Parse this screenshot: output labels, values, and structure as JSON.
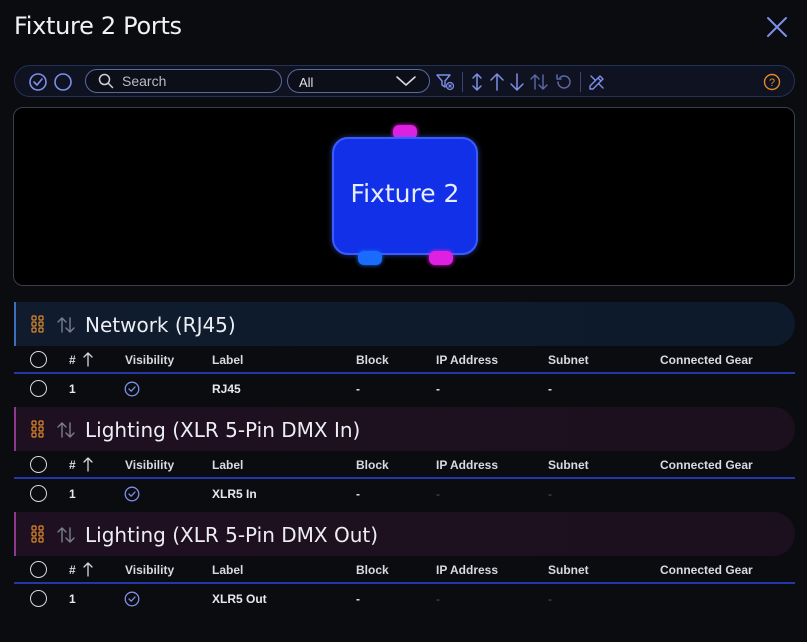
{
  "window": {
    "title": "Fixture 2 Ports"
  },
  "toolbar": {
    "search_placeholder": "Search",
    "filter_value": "All"
  },
  "canvas": {
    "fixture_label": "Fixture 2",
    "colors": {
      "body": "#1130e8",
      "port_magenta": "#e020e0",
      "port_blue": "#1a6cff"
    }
  },
  "columns": {
    "num": "#",
    "visibility": "Visibility",
    "label": "Label",
    "block": "Block",
    "ip": "IP Address",
    "subnet": "Subnet",
    "gear": "Connected Gear"
  },
  "sections": [
    {
      "title": "Network (RJ45)",
      "rows": [
        {
          "num": "1",
          "label": "RJ45",
          "block": "-",
          "ip": "-",
          "subnet": "-"
        }
      ]
    },
    {
      "title": "Lighting (XLR 5-Pin DMX In)",
      "rows": [
        {
          "num": "1",
          "label": "XLR5 In",
          "block": "-",
          "ip": "-",
          "subnet": "-"
        }
      ]
    },
    {
      "title": "Lighting (XLR 5-Pin DMX Out)",
      "rows": [
        {
          "num": "1",
          "label": "XLR5 Out",
          "block": "-",
          "ip": "-",
          "subnet": "-"
        }
      ]
    }
  ]
}
